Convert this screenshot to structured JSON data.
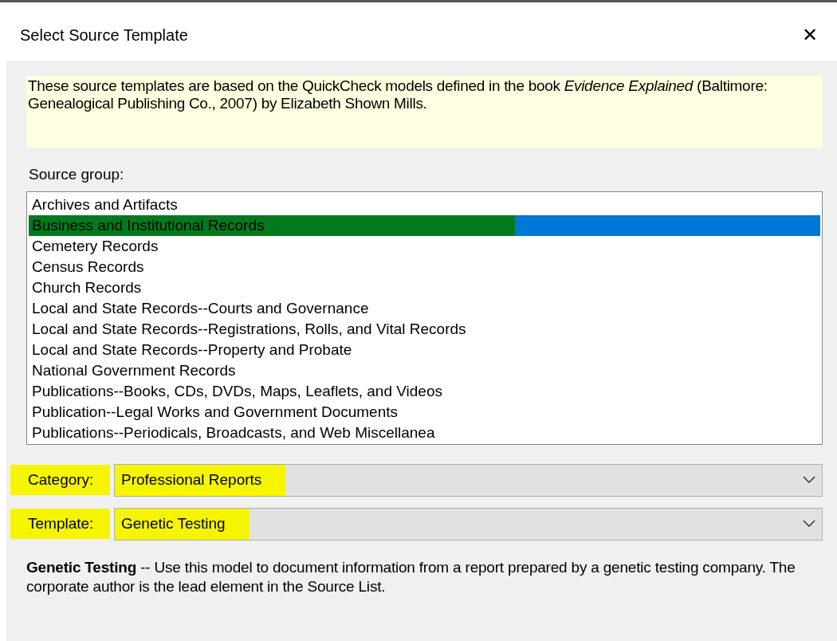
{
  "window": {
    "title": "Select Source Template",
    "close": "✕"
  },
  "info": {
    "text": "These source templates are based on the QuickCheck models defined in the book *Evidence Explained* (Baltimore: Genealogical Publishing Co., 2007) by Elizabeth Shown Mills."
  },
  "source_group": {
    "label": "Source group:",
    "items": [
      {
        "label": "Archives and Artifacts",
        "selected": false,
        "highlighted": false
      },
      {
        "label": "Business and Institutional Records",
        "selected": true,
        "highlighted": true
      },
      {
        "label": "Cemetery Records",
        "selected": false,
        "highlighted": false
      },
      {
        "label": "Census Records",
        "selected": false,
        "highlighted": false
      },
      {
        "label": "Church Records",
        "selected": false,
        "highlighted": false
      },
      {
        "label": "Local and State Records--Courts and Governance",
        "selected": false,
        "highlighted": false
      },
      {
        "label": "Local and State Records--Registrations, Rolls, and Vital Records",
        "selected": false,
        "highlighted": false
      },
      {
        "label": "Local and State Records--Property and Probate",
        "selected": false,
        "highlighted": false
      },
      {
        "label": "National Government Records",
        "selected": false,
        "highlighted": false
      },
      {
        "label": "Publications--Books, CDs, DVDs, Maps, Leaflets, and Videos",
        "selected": false,
        "highlighted": false
      },
      {
        "label": "Publication--Legal Works and Government Documents",
        "selected": false,
        "highlighted": false
      },
      {
        "label": "Publications--Periodicals, Broadcasts, and Web Miscellanea",
        "selected": false,
        "highlighted": false
      }
    ]
  },
  "fields": [
    {
      "label": "Category:",
      "value": "Professional Reports",
      "highlighted": true
    },
    {
      "label": "Template:",
      "value": "Genetic Testing",
      "highlighted": true
    }
  ],
  "description": {
    "title": "Genetic Testing",
    "text": " -- Use this model to document information from a report prepared by a genetic testing company.  The corporate author is the lead element in the Source List."
  }
}
